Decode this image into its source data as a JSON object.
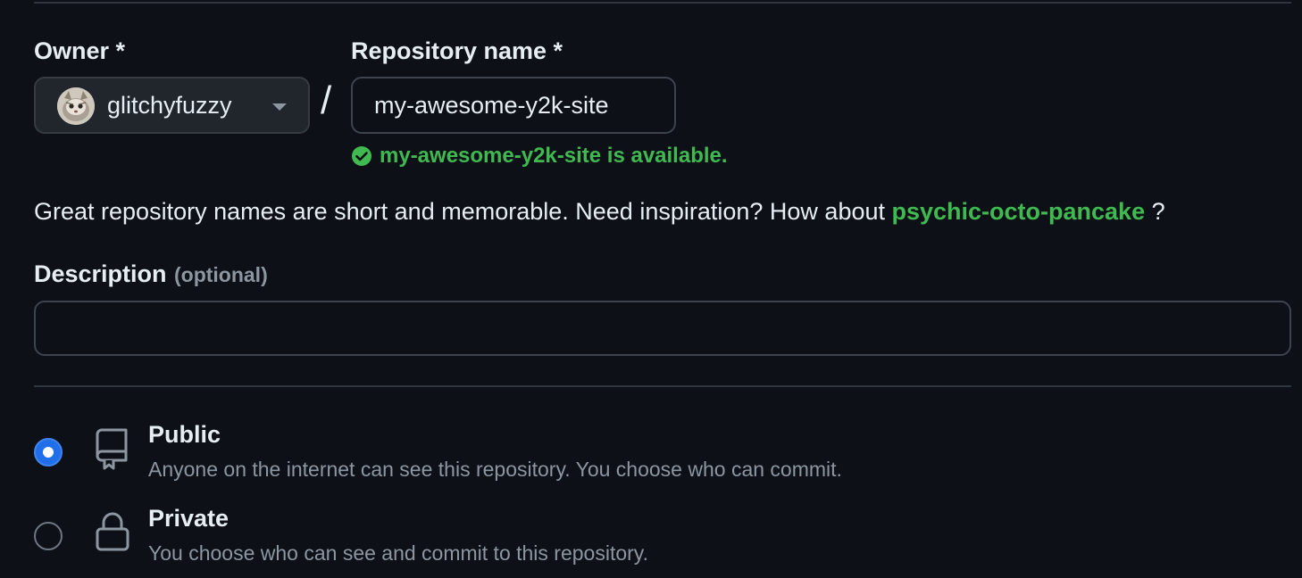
{
  "form": {
    "owner_label": "Owner *",
    "repo_label": "Repository name *",
    "owner_value": "glitchyfuzzy",
    "slash": "/",
    "repo_value": "my-awesome-y2k-site",
    "availability_message": "my-awesome-y2k-site is available.",
    "hint_prefix": "Great repository names are short and memorable. Need inspiration? How about ",
    "hint_suggestion": "psychic-octo-pancake",
    "hint_suffix": " ?",
    "description_label": "Description",
    "description_optional": "(optional)",
    "description_value": ""
  },
  "visibility": {
    "options": [
      {
        "title": "Public",
        "description": "Anyone on the internet can see this repository. You choose who can commit.",
        "icon": "repo-book-icon",
        "selected": true
      },
      {
        "title": "Private",
        "description": "You choose who can see and commit to this repository.",
        "icon": "lock-icon",
        "selected": false
      }
    ]
  },
  "colors": {
    "background": "#0d1117",
    "text": "#e6edf3",
    "muted": "#8d96a0",
    "success": "#3fb950",
    "accent": "#1f6feb"
  }
}
